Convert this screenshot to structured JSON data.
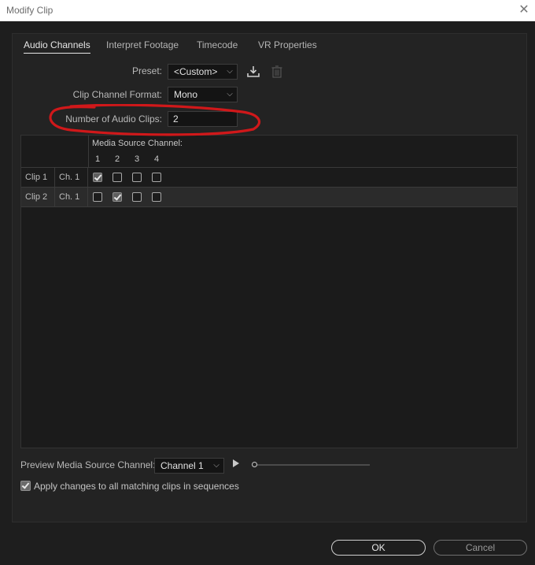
{
  "window": {
    "title": "Modify Clip",
    "close_glyph": "✕"
  },
  "tabs": [
    {
      "label": "Audio Channels",
      "active": true
    },
    {
      "label": "Interpret Footage",
      "active": false
    },
    {
      "label": "Timecode",
      "active": false
    },
    {
      "label": "VR Properties",
      "active": false
    }
  ],
  "preset": {
    "label": "Preset:",
    "value": "<Custom>",
    "save_icon": "download-icon",
    "delete_icon": "trash-icon"
  },
  "channel_format": {
    "label": "Clip Channel Format:",
    "value": "Mono"
  },
  "audio_clips": {
    "label": "Number of Audio Clips:",
    "value": "2"
  },
  "grid": {
    "header_label": "Media Source Channel:",
    "channel_numbers": [
      "1",
      "2",
      "3",
      "4"
    ],
    "rows": [
      {
        "clip": "Clip 1",
        "channel": "Ch. 1",
        "checked": [
          true,
          false,
          false,
          false
        ]
      },
      {
        "clip": "Clip 2",
        "channel": "Ch. 1",
        "checked": [
          false,
          true,
          false,
          false
        ]
      }
    ]
  },
  "preview": {
    "label": "Preview Media Source Channel:",
    "value": "Channel 1",
    "play_icon": "play-icon"
  },
  "apply_all": {
    "label": "Apply changes to all matching clips in sequences",
    "checked": true
  },
  "buttons": {
    "ok": "OK",
    "cancel": "Cancel"
  },
  "colors": {
    "background": "#1e1e1e",
    "panel": "#232323",
    "annotation": "#d0181a"
  }
}
